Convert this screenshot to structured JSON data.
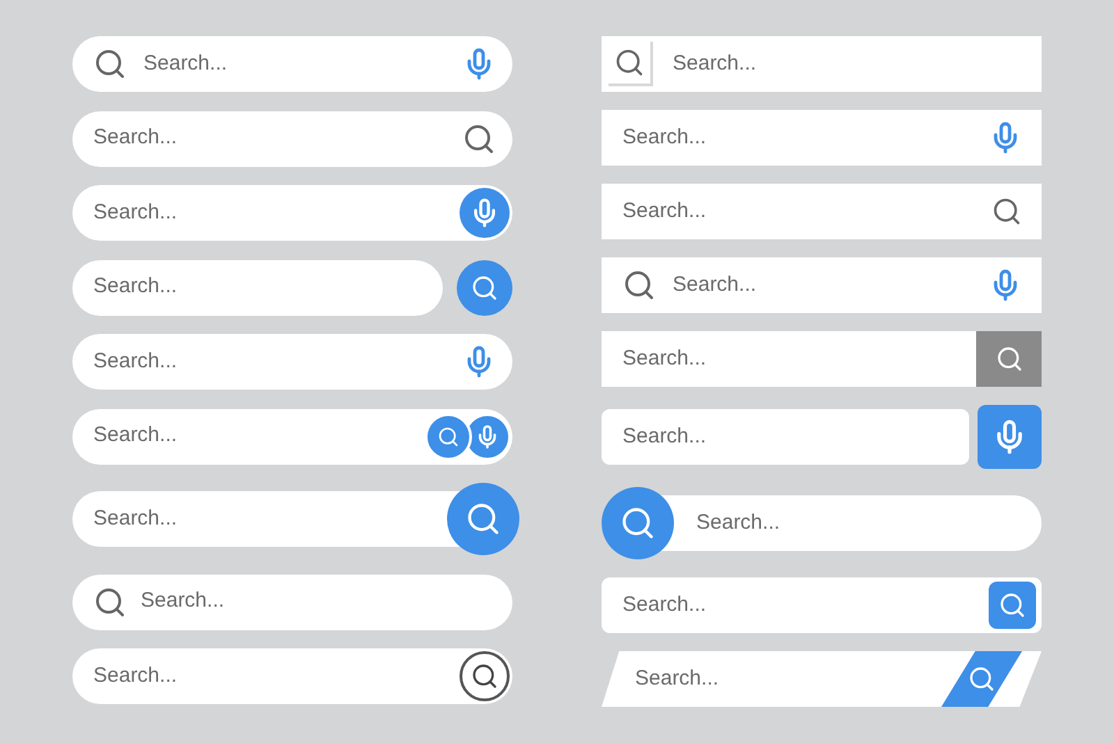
{
  "left_column": [
    {
      "kind": "pill-icon-mic",
      "placeholder": "Search..."
    },
    {
      "kind": "pill-search",
      "placeholder": "Search..."
    },
    {
      "kind": "pill-mic-button",
      "placeholder": "Search..."
    },
    {
      "kind": "pill-separate-search-button",
      "placeholder": "Search..."
    },
    {
      "kind": "pill-mic",
      "placeholder": "Search..."
    },
    {
      "kind": "pill-search-mic-buttons",
      "placeholder": "Search..."
    },
    {
      "kind": "pill-big-search-button",
      "placeholder": "Search..."
    },
    {
      "kind": "pill-icon",
      "placeholder": "Search..."
    },
    {
      "kind": "pill-outline-search-button",
      "placeholder": "Search..."
    }
  ],
  "right_column": [
    {
      "kind": "rect-boxed-search",
      "placeholder": "Search..."
    },
    {
      "kind": "rect-mic",
      "placeholder": "Search..."
    },
    {
      "kind": "rect-search",
      "placeholder": "Search..."
    },
    {
      "kind": "rect-icon-mic",
      "placeholder": "Search..."
    },
    {
      "kind": "rect-grey-search-button",
      "placeholder": "Search..."
    },
    {
      "kind": "rounded-separate-mic-button",
      "placeholder": "Search..."
    },
    {
      "kind": "pill-lead-search-button",
      "placeholder": "Search..."
    },
    {
      "kind": "rounded-search-button",
      "placeholder": "Search..."
    },
    {
      "kind": "slanted",
      "placeholder": "Search..."
    }
  ]
}
